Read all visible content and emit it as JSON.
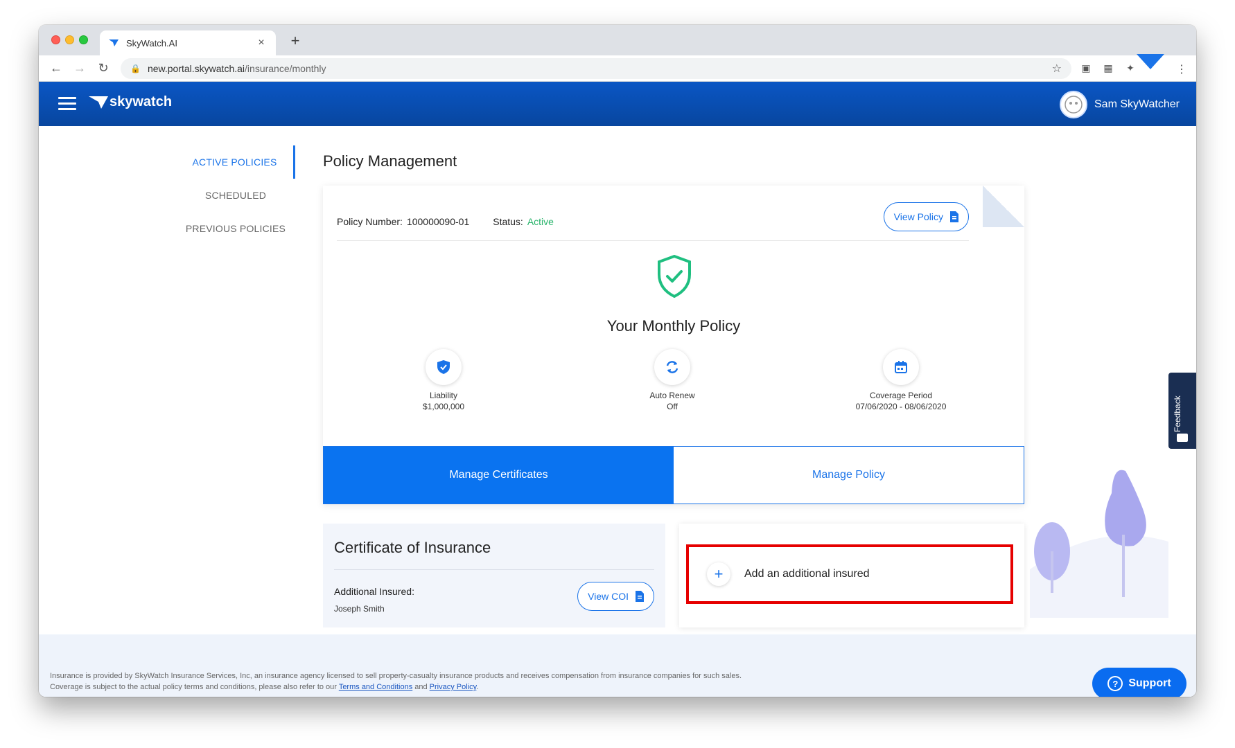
{
  "browser": {
    "tab_title": "SkyWatch.AI",
    "tab_close": "×",
    "new_tab": "+",
    "url_host": "new.portal.skywatch.ai",
    "url_path": "/insurance/monthly",
    "icons": [
      "back-icon",
      "forward-icon",
      "reload-icon",
      "lock-icon",
      "star-icon",
      "extension-icon",
      "menu-icon"
    ]
  },
  "app": {
    "logo_text": "skywatch",
    "user_name": "Sam SkyWatcher",
    "brand_color": "#0a56c4",
    "accent_color": "#1a73e8"
  },
  "sidebar": {
    "items": [
      {
        "label": "ACTIVE POLICIES",
        "active": true
      },
      {
        "label": "SCHEDULED",
        "active": false
      },
      {
        "label": "PREVIOUS POLICIES",
        "active": false
      }
    ]
  },
  "page": {
    "title": "Policy Management"
  },
  "policy": {
    "number_label": "Policy Number:",
    "number": "100000090-01",
    "status_label": "Status:",
    "status": "Active",
    "status_color": "#27b36a",
    "view_policy_label": "View Policy",
    "heading": "Your Monthly Policy",
    "stats": [
      {
        "name": "Liability",
        "value": "$1,000,000",
        "icon": "shield-check-icon"
      },
      {
        "name": "Auto Renew",
        "value": "Off",
        "icon": "refresh-icon"
      },
      {
        "name": "Coverage Period",
        "value": "07/06/2020 - 08/06/2020",
        "icon": "calendar-icon"
      }
    ],
    "manage_certificates_label": "Manage Certificates",
    "manage_policy_label": "Manage Policy"
  },
  "certificate": {
    "title": "Certificate of Insurance",
    "additional_insured_label": "Additional Insured:",
    "insured_name": "Joseph Smith",
    "view_coi_label": "View COI"
  },
  "add_insured": {
    "label": "Add an additional insured",
    "plus": "+"
  },
  "feedback": {
    "label": "Feedback"
  },
  "footer": {
    "disclaimer_1": "Insurance is provided by SkyWatch Insurance Services, Inc, an insurance agency licensed to sell property-casualty insurance products and receives compensation from insurance companies for such sales. Coverage is subject to the actual policy terms and conditions, please also refer to our ",
    "terms_link": "Terms and Conditions",
    "and_text": " and ",
    "privacy_link": "Privacy Policy",
    "period": ".",
    "support_label": "Support",
    "support_icon_text": "?"
  }
}
